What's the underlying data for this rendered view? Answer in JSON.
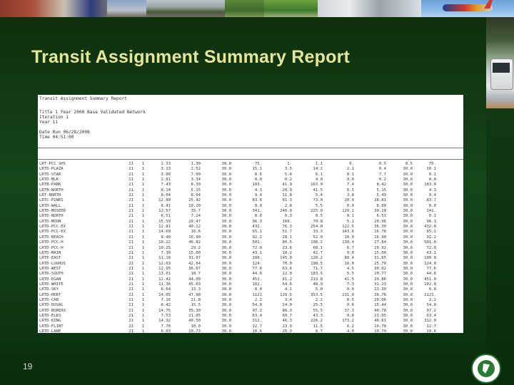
{
  "slide": {
    "title": "Transit Assignment Summary Report",
    "page_number": "19"
  },
  "report": {
    "header_lines": [
      "Transit Assignment Summary Report",
      "",
      "Title 1 Year 2000 Base Validated Network",
      "Iteration 1",
      "Year 11",
      "",
      "Date Run 06/28/2008",
      "Time 04:51:00"
    ],
    "rows": [
      [
        "LRT-PCC SHS",
        "21",
        "1",
        "2.33",
        "1.30",
        "30.0",
        "75.",
        "1.",
        "1.1",
        "0.",
        "0.5",
        "0.5",
        "75."
      ],
      [
        "LRTD-PLAZA",
        "21",
        "1",
        "3.13",
        "2.52",
        "30.0",
        "15.1",
        "3.5",
        "14.2",
        "2.1",
        "0.4",
        "30.0",
        "10.1"
      ],
      [
        "LRTD-STAR",
        "21",
        "1",
        "3.00",
        "7.00",
        "30.0",
        "0.6",
        "5.4",
        "6.1",
        "0.1",
        "7.7",
        "30.0",
        "0.1"
      ],
      [
        "LRTD-MLK-",
        "21",
        "1",
        "2.81",
        "3.34",
        "30.0",
        "0.0",
        "0.2",
        "4.0",
        "0.0",
        "0.2",
        "30.0",
        "0.0"
      ],
      [
        "LRTB-PARK",
        "21",
        "1",
        "7.43",
        "8.30",
        "30.0",
        "183.",
        "41.9",
        "163.0",
        "7.4",
        "8.42",
        "30.0",
        "183.0"
      ],
      [
        "LRTB-NORTH",
        "21",
        "1",
        "6.14",
        "5.15",
        "30.0",
        "4.3",
        "20.9",
        "41.5",
        "0.5",
        "5.15",
        "30.0",
        "4.3"
      ],
      [
        "LRT-NORTH",
        "21",
        "1",
        "8.04",
        "8.04",
        "30.0",
        "9.4",
        "11.8",
        "5.4",
        "3.8",
        "5.49",
        "30.0",
        "9.4"
      ],
      [
        "LRTC-PINES",
        "21",
        "1",
        "12.80",
        "25.42",
        "30.0",
        "83.6",
        "61.3",
        "73.0",
        "20.9",
        "28.81",
        "30.0",
        "83.7"
      ],
      [
        "LRTD-WALL",
        "21",
        "1",
        "8.41",
        "10.20",
        "30.0",
        "8.0",
        "2.8",
        "5.5",
        "0.0",
        "8.00",
        "30.0",
        "8.0"
      ],
      [
        "LRTD-MOSEDD",
        "21",
        "1",
        "12.57",
        "35.7",
        "30.0",
        "341.",
        "240.0",
        "225.0",
        "129.1",
        "30.28",
        "30.0",
        "341."
      ],
      [
        "LRTD-NORTH",
        "21",
        "1",
        "6.51",
        "7.24",
        "30.0",
        "0.0",
        "0.3",
        "0.5",
        "0.1",
        "6.51",
        "30.0",
        "0.1"
      ],
      [
        "LRTD-MOON",
        "21",
        "1",
        "15.59",
        "20.47",
        "30.0",
        "96.3",
        "160.",
        "70.8",
        "5.1",
        "20.96",
        "30.0",
        "96.3"
      ],
      [
        "LRTD-PCC-EX",
        "21",
        "1",
        "12.81",
        "40.12",
        "30.0",
        "432.",
        "76.3",
        "254.0",
        "122.5",
        "36.30",
        "30.0",
        "432.0"
      ],
      [
        "LRTD-PCC-EX",
        "21",
        "1",
        "14.60",
        "16.6",
        "30.0",
        "65.1",
        "51.7",
        "33.3",
        "143.6",
        "16.78",
        "30.0",
        "65.1"
      ],
      [
        "LRTD-BEACH",
        "21",
        "1",
        "8.40",
        "16.90",
        "30.0",
        "92.2",
        "28.1",
        "52.0",
        "10.0",
        "16.90",
        "30.0",
        "92.2"
      ],
      [
        "LRTD-PCC-H",
        "21",
        "1",
        "10.22",
        "46.82",
        "30.0",
        "501.",
        "80.5",
        "108.2",
        "130.4",
        "27.84",
        "30.0",
        "501.0"
      ],
      [
        "LRTD-PCC-H",
        "21",
        "1",
        "10.25",
        "29.2",
        "30.0",
        "72.9",
        "23.6",
        "60.1",
        "6.7",
        "29.92",
        "30.0",
        "72.9"
      ],
      [
        "LRTD-MAIN",
        "21",
        "1",
        "7.30",
        "15.00",
        "30.0",
        "43.1",
        "10.2",
        "42.7",
        "0.0",
        "15.00",
        "30.0",
        "43.1"
      ],
      [
        "LRTE-EAST",
        "21",
        "1",
        "11.18",
        "31.07",
        "30.0",
        "100.",
        "145.0",
        "120.2",
        "80.4",
        "31.65",
        "30.0",
        "100.0"
      ],
      [
        "LRTD-LUGHUS",
        "21",
        "1",
        "12.03",
        "42.84",
        "30.0",
        "124.",
        "70.0",
        "198.5",
        "16.0",
        "25.70",
        "30.0",
        "124.0"
      ],
      [
        "LRTD-WEST",
        "21",
        "1",
        "12.95",
        "36.67",
        "30.0",
        "77.6",
        "63.6",
        "71.7",
        "4.5",
        "30.02",
        "30.0",
        "77.6"
      ],
      [
        "LRTD-SOUTH",
        "21",
        "1",
        "13.01",
        "18.7",
        "30.0",
        "44.6",
        "22.0",
        "183.5",
        "5.5",
        "20.77",
        "30.0",
        "44.6"
      ],
      [
        "LRTD-EGAN",
        "21",
        "1",
        "12.42",
        "44.00",
        "30.0",
        "451.",
        "81.2",
        "213.8",
        "41.5",
        "29.86",
        "30.0",
        "451.0"
      ],
      [
        "LRTD-WHITE",
        "21",
        "1",
        "11.36",
        "45.03",
        "30.0",
        "102.",
        "54.6",
        "48.9",
        "7.3",
        "31.23",
        "30.0",
        "102.0"
      ],
      [
        "LRTD-SKY",
        "21",
        "1",
        "6.64",
        "13.3",
        "30.0",
        "0.0",
        "4.1",
        "5.0",
        "0.0",
        "13.30",
        "30.0",
        "0.0"
      ],
      [
        "LRTD-HERT",
        "21",
        "1",
        "14.05",
        "47.98",
        "30.0",
        "1121",
        "129.5",
        "353.5",
        "231.0",
        "38.76",
        "30.0",
        "1121."
      ],
      [
        "LRTD-CAB",
        "21",
        "1",
        "7.16",
        "21.8",
        "30.0",
        "2.2",
        "3.4",
        "2.2",
        "0.5",
        "20.06",
        "30.0",
        "2.2"
      ],
      [
        "LRTD-DUVAL",
        "21",
        "1",
        "6.42",
        "15.5",
        "30.0",
        "54.0",
        "24.0",
        "25.5",
        "0.6",
        "15.44",
        "30.0",
        "54.0"
      ],
      [
        "LRTD-BOREAS",
        "21",
        "1",
        "14.75",
        "35.30",
        "30.0",
        "97.2",
        "88.3",
        "55.5",
        "37.3",
        "40.78",
        "30.0",
        "97.2"
      ],
      [
        "LRTD-ELKS",
        "21",
        "1",
        "7.53",
        "21.05",
        "30.0",
        "63.4",
        "60.7",
        "43.3",
        "0.8",
        "21.05",
        "30.0",
        "63.4"
      ],
      [
        "LRTD-KING",
        "21",
        "1",
        "14.32",
        "40.50",
        "30.0",
        "312.",
        "46.3",
        "226.2",
        "173.2",
        "40.61",
        "30.0",
        "312.0"
      ],
      [
        "LRTD-FLINT",
        "21",
        "1",
        "7.70",
        "10.0",
        "30.0",
        "12.7",
        "23.9",
        "11.5",
        "6.2",
        "10.70",
        "30.0",
        "12.7"
      ],
      [
        "LRTD-LANE",
        "21",
        "1",
        "6.03",
        "10.73",
        "30.0",
        "10.6",
        "20.3",
        "8.7",
        "4.0",
        "10.70",
        "30.0",
        "10.6"
      ],
      [
        "LRTD-ROSE",
        "21",
        "1",
        "11.10",
        "27.04",
        "30.0",
        "37.3",
        "46.4",
        "28.0",
        "5.6",
        "27.04",
        "30.0",
        "37.3"
      ],
      [
        "LRTD-NOVA",
        "21",
        "1",
        "11.08",
        "44.17",
        "30.0",
        "1055",
        "160.0",
        "1100.0",
        "63.8",
        "31.46",
        "30.0",
        "1055."
      ],
      [
        "LRTD-HAWK",
        "21",
        "2",
        "11.41",
        "25.17",
        "30.0",
        "88.5",
        "61.0",
        "45.1",
        "11.8",
        "28.66",
        "30.0",
        "88.5"
      ],
      [
        "LRTD-VERA",
        "21",
        "1",
        "8.00",
        "24.8",
        "30.0",
        "40.6",
        "53.2",
        "32.6",
        "17.5",
        "14.88",
        "30.0",
        "40.6"
      ]
    ]
  }
}
